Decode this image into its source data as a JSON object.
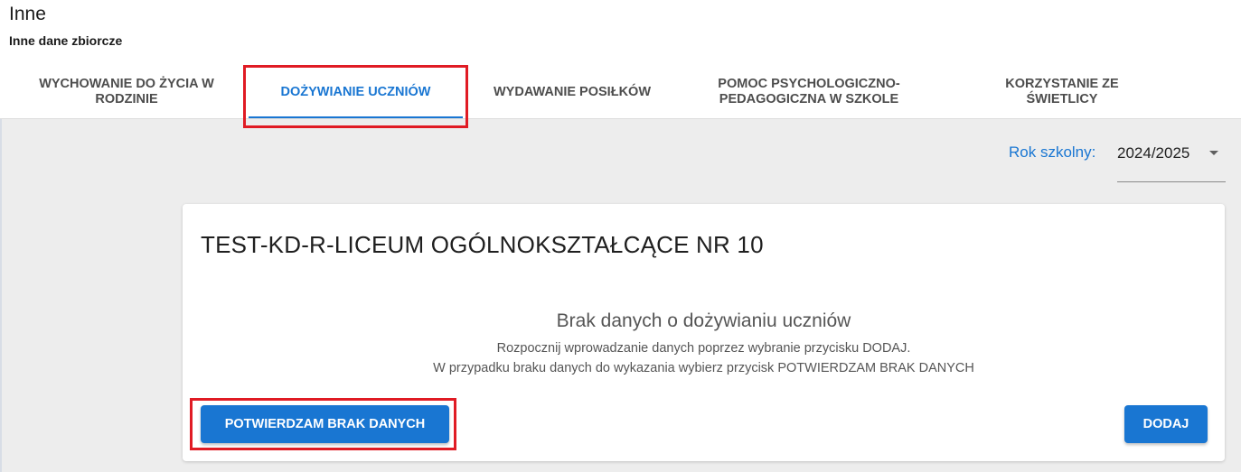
{
  "page": {
    "title": "Inne",
    "subtitle": "Inne dane zbiorcze"
  },
  "tabs": [
    {
      "label": "WYCHOWANIE DO ŻYCIA W RODZINIE",
      "active": false
    },
    {
      "label": "DOŻYWIANIE UCZNIÓW",
      "active": true
    },
    {
      "label": "WYDAWANIE POSIŁKÓW",
      "active": false
    },
    {
      "label": "POMOC PSYCHOLOGICZNO-PEDAGOGICZNA W SZKOLE",
      "active": false
    },
    {
      "label": "KORZYSTANIE ZE ŚWIETLICY",
      "active": false
    }
  ],
  "year_filter": {
    "label": "Rok szkolny:",
    "value": "2024/2025",
    "icon": "chevron-down-icon"
  },
  "card": {
    "school_name": "TEST-KD-R-LICEUM OGÓLNOKSZTAŁCĄCE NR 10",
    "empty_title": "Brak danych o dożywianiu uczniów",
    "empty_line1": "Rozpocznij wprowadzanie danych poprzez wybranie przycisku DODAJ.",
    "empty_line2": "W przypadku braku danych do wykazania wybierz przycisk POTWIERDZAM BRAK DANYCH",
    "confirm_button": "POTWIERDZAM BRAK DANYCH",
    "add_button": "DODAJ"
  },
  "colors": {
    "accent": "#1976d2",
    "highlight": "#e01b24",
    "background": "#ededed"
  }
}
